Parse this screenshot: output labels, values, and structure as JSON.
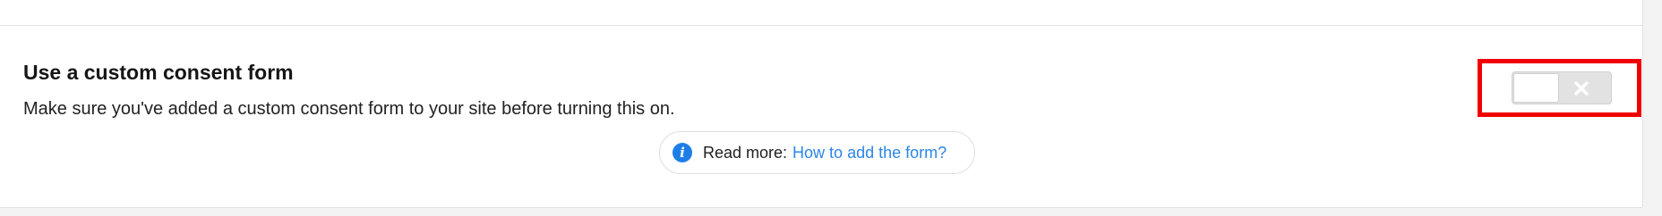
{
  "setting": {
    "title": "Use a custom consent form",
    "description": "Make sure you've added a custom consent form to your site before turning this on.",
    "read_more": {
      "label": "Read more:",
      "link_text": "How to add the form?",
      "icon": "info-icon"
    },
    "toggle": {
      "state": "off",
      "off_icon": "close-icon"
    }
  },
  "colors": {
    "accent_blue": "#2a86e8",
    "highlight_red": "#f00000",
    "toggle_off_bg": "#e2e2e2"
  }
}
